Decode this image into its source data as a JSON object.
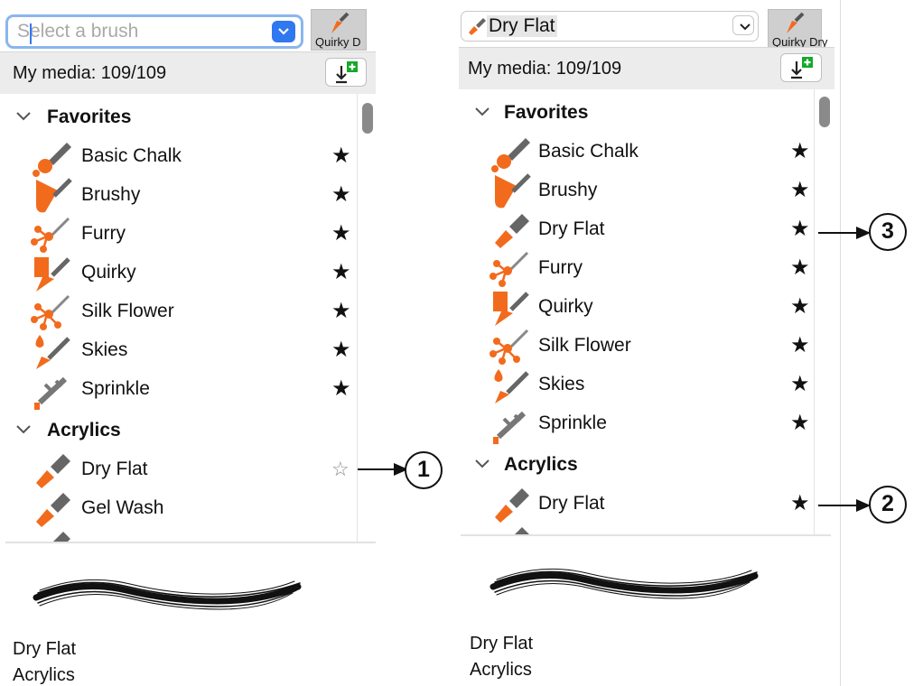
{
  "left_panel": {
    "search_placeholder": "Select a brush",
    "thumbnail_label": "Quirky D",
    "media_count": "My media: 109/109",
    "favorites_label": "Favorites",
    "favorites": [
      {
        "name": "Basic Chalk",
        "star": "★"
      },
      {
        "name": "Brushy",
        "star": "★"
      },
      {
        "name": "Furry",
        "star": "★"
      },
      {
        "name": "Quirky",
        "star": "★"
      },
      {
        "name": "Silk Flower",
        "star": "★"
      },
      {
        "name": "Skies",
        "star": "★"
      },
      {
        "name": "Sprinkle",
        "star": "★"
      }
    ],
    "acrylics_label": "Acrylics",
    "acrylics": [
      {
        "name": "Dry Flat",
        "star": "☆"
      },
      {
        "name": "Gel Wash",
        "star": ""
      }
    ],
    "info_brush": "Dry Flat",
    "info_category": "Acrylics"
  },
  "right_panel": {
    "selected_brush": "Dry Flat",
    "thumbnail_label": "Quirky Dry",
    "media_count": "My media: 109/109",
    "favorites_label": "Favorites",
    "favorites": [
      {
        "name": "Basic Chalk",
        "star": "★"
      },
      {
        "name": "Brushy",
        "star": "★"
      },
      {
        "name": "Dry Flat",
        "star": "★"
      },
      {
        "name": "Furry",
        "star": "★"
      },
      {
        "name": "Quirky",
        "star": "★"
      },
      {
        "name": "Silk Flower",
        "star": "★"
      },
      {
        "name": "Skies",
        "star": "★"
      },
      {
        "name": "Sprinkle",
        "star": "★"
      }
    ],
    "acrylics_label": "Acrylics",
    "acrylics": [
      {
        "name": "Dry Flat",
        "star": "★"
      }
    ],
    "info_brush": "Dry Flat",
    "info_category": "Acrylics"
  },
  "callouts": {
    "one": "1",
    "two": "2",
    "three": "3"
  },
  "colors": {
    "brush_orange": "#f26b1d",
    "brush_gray": "#666666",
    "accent_blue": "#2f78ef"
  }
}
